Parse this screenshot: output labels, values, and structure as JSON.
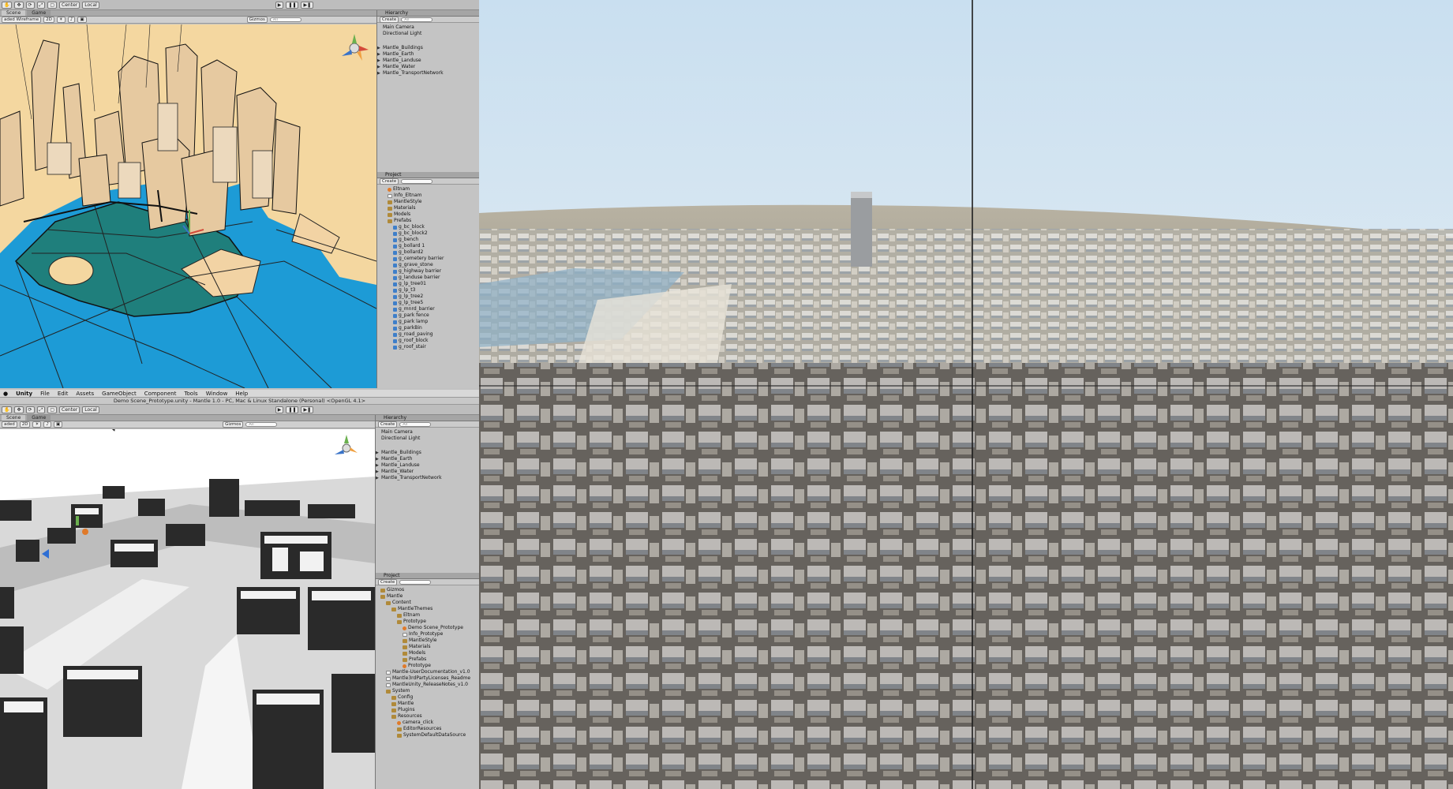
{
  "top_editor": {
    "toolbar": {
      "pivot_label": "Center",
      "space_label": "Local"
    },
    "tabs": [
      "Scene",
      "Game"
    ],
    "scene_bar": {
      "shading_mode": "aded Wireframe",
      "mode_2d": "2D",
      "gizmos_label": "Gizmos",
      "search_placeholder": "All"
    },
    "hierarchy": {
      "title": "Hierarchy",
      "create_label": "Create",
      "search_placeholder": "All",
      "items": [
        {
          "label": "Main Camera",
          "expandable": false
        },
        {
          "label": "Directional Light",
          "expandable": false
        },
        {
          "label": "Mantle_Buildings",
          "expandable": true
        },
        {
          "label": "Mantle_Earth",
          "expandable": true
        },
        {
          "label": "Mantle_Landuse",
          "expandable": true
        },
        {
          "label": "Mantle_Water",
          "expandable": true
        },
        {
          "label": "Mantle_TransportNetwork",
          "expandable": true
        }
      ]
    },
    "project": {
      "title": "Project",
      "create_label": "Create",
      "items": [
        {
          "label": "Eltnam",
          "type": "scene",
          "indent": 1
        },
        {
          "label": "Info_Eltnam",
          "type": "file",
          "indent": 1
        },
        {
          "label": "MantleStyle",
          "type": "folder",
          "indent": 1
        },
        {
          "label": "Materials",
          "type": "folder",
          "indent": 1
        },
        {
          "label": "Models",
          "type": "folder",
          "indent": 1
        },
        {
          "label": "Prefabs",
          "type": "folder",
          "indent": 1
        },
        {
          "label": "g_bc_block",
          "type": "prefab",
          "indent": 2
        },
        {
          "label": "g_bc_block2",
          "type": "prefab",
          "indent": 2
        },
        {
          "label": "g_bench",
          "type": "prefab",
          "indent": 2
        },
        {
          "label": "g_bollard 1",
          "type": "prefab",
          "indent": 2
        },
        {
          "label": "g_bollard2",
          "type": "prefab",
          "indent": 2
        },
        {
          "label": "g_cemetery barrier",
          "type": "prefab",
          "indent": 2
        },
        {
          "label": "g_grave_stone",
          "type": "prefab",
          "indent": 2
        },
        {
          "label": "g_highway barrier",
          "type": "prefab",
          "indent": 2
        },
        {
          "label": "g_landuse barrier",
          "type": "prefab",
          "indent": 2
        },
        {
          "label": "g_lp_tree01",
          "type": "prefab",
          "indent": 2
        },
        {
          "label": "g_lp_t3",
          "type": "prefab",
          "indent": 2
        },
        {
          "label": "g_lp_tree2",
          "type": "prefab",
          "indent": 2
        },
        {
          "label": "g_lp_tree5",
          "type": "prefab",
          "indent": 2
        },
        {
          "label": "g_mnrd_barrier",
          "type": "prefab",
          "indent": 2
        },
        {
          "label": "g_park fence",
          "type": "prefab",
          "indent": 2
        },
        {
          "label": "g_park lamp",
          "type": "prefab",
          "indent": 2
        },
        {
          "label": "g_parkBin",
          "type": "prefab",
          "indent": 2
        },
        {
          "label": "g_road_paving",
          "type": "prefab",
          "indent": 2
        },
        {
          "label": "g_roof_block",
          "type": "prefab",
          "indent": 2
        },
        {
          "label": "g_roof_stair",
          "type": "prefab",
          "indent": 2
        }
      ]
    }
  },
  "bottom_editor": {
    "menubar": [
      "Unity",
      "File",
      "Edit",
      "Assets",
      "GameObject",
      "Component",
      "Tools",
      "Window",
      "Help"
    ],
    "window_title": "Demo Scene_Prototype.unity - Mantle 1.0 - PC, Mac & Linux Standalone (Personal) <OpenGL 4.1>",
    "toolbar": {
      "pivot_label": "Center",
      "space_label": "Local"
    },
    "tabs": [
      "Scene",
      "Game"
    ],
    "scene_bar": {
      "shading_mode": "aded",
      "mode_2d": "2D",
      "gizmos_label": "Gizmos",
      "search_placeholder": "All"
    },
    "hierarchy": {
      "title": "Hierarchy",
      "create_label": "Create",
      "search_placeholder": "All",
      "items": [
        {
          "label": "Main Camera",
          "expandable": false
        },
        {
          "label": "Directional Light",
          "expandable": false
        },
        {
          "label": "Mantle_Buildings",
          "expandable": true
        },
        {
          "label": "Mantle_Earth",
          "expandable": true
        },
        {
          "label": "Mantle_Landuse",
          "expandable": true
        },
        {
          "label": "Mantle_Water",
          "expandable": true
        },
        {
          "label": "Mantle_TransportNetwork",
          "expandable": true
        }
      ]
    },
    "project": {
      "title": "Project",
      "create_label": "Create",
      "items": [
        {
          "label": "Gizmos",
          "type": "folder",
          "indent": 0
        },
        {
          "label": "Mantle",
          "type": "folder",
          "indent": 0
        },
        {
          "label": "Content",
          "type": "folder",
          "indent": 1
        },
        {
          "label": "MantleThemes",
          "type": "folder",
          "indent": 2
        },
        {
          "label": "Eltnam",
          "type": "folder",
          "indent": 3
        },
        {
          "label": "Prototype",
          "type": "folder",
          "indent": 3
        },
        {
          "label": "Demo Scene_Prototype",
          "type": "scene",
          "indent": 4
        },
        {
          "label": "Info_Prototype",
          "type": "file",
          "indent": 4
        },
        {
          "label": "MantleStyle",
          "type": "folder",
          "indent": 4
        },
        {
          "label": "Materials",
          "type": "folder",
          "indent": 4
        },
        {
          "label": "Models",
          "type": "folder",
          "indent": 4
        },
        {
          "label": "Prefabs",
          "type": "folder",
          "indent": 4
        },
        {
          "label": "Prototype",
          "type": "scene",
          "indent": 4
        },
        {
          "label": "Mantle-UserDocumentation_v1.0",
          "type": "file",
          "indent": 1
        },
        {
          "label": "Mantle3rdPartyLicenses_Readme",
          "type": "file",
          "indent": 1
        },
        {
          "label": "MantleUnity_ReleaseNotes_v1.0",
          "type": "file",
          "indent": 1
        },
        {
          "label": "System",
          "type": "folder",
          "indent": 1
        },
        {
          "label": "Config",
          "type": "folder",
          "indent": 2
        },
        {
          "label": "Mantle",
          "type": "folder",
          "indent": 2
        },
        {
          "label": "Plugins",
          "type": "folder",
          "indent": 2
        },
        {
          "label": "Resources",
          "type": "folder",
          "indent": 2
        },
        {
          "label": "camera_click",
          "type": "scene",
          "indent": 3
        },
        {
          "label": "EditorResources",
          "type": "folder",
          "indent": 3
        },
        {
          "label": "SystemDefaultDataSource",
          "type": "folder",
          "indent": 3
        }
      ]
    }
  },
  "colors": {
    "editor_bg": "#c2c2c2",
    "selection": "#8aa7c9",
    "water": "#1d9bd6",
    "park": "#1f7f7c",
    "sand": "#f4d7a0",
    "sky": "#cfe3f1"
  }
}
